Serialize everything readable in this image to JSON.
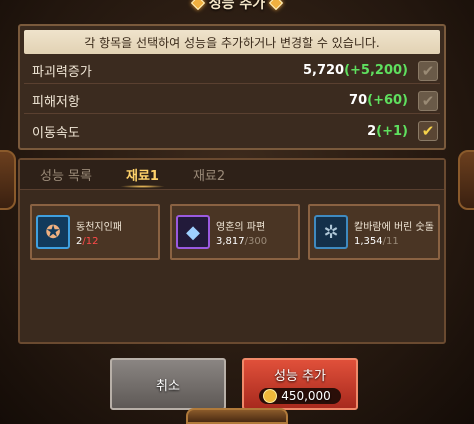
{
  "dialog": {
    "title": "성능 추가",
    "notice": "각 항목을 선택하여 성능을 추가하거나 변경할 수 있습니다."
  },
  "stats": [
    {
      "name": "파괴력증가",
      "value": "5,720",
      "bonus": "(+5,200)",
      "checked": false
    },
    {
      "name": "피해저항",
      "value": "70",
      "bonus": "(+60)",
      "checked": false
    },
    {
      "name": "이동속도",
      "value": "2",
      "bonus": "(+1)",
      "checked": true
    }
  ],
  "tabs": [
    "성능 목록",
    "재료1",
    "재료2"
  ],
  "active_tab": "재료1",
  "materials": [
    {
      "name": "동천지인패",
      "have": "2",
      "need": "/12",
      "icon": "star-medal-icon"
    },
    {
      "name": "영혼의 파편",
      "have": "3,817",
      "need": "/300",
      "icon": "soul-shard-icon"
    },
    {
      "name": "칼바람에 버린 숫돌",
      "have": "1,354",
      "need": "/11",
      "icon": "whetstone-icon"
    }
  ],
  "buttons": {
    "cancel": "취소",
    "add": "성능 추가",
    "cost": "450,000"
  },
  "colors": {
    "bonus": "#5fe05f",
    "active_tab": "#ffd26a",
    "insufficient": "#ff4a4a"
  }
}
